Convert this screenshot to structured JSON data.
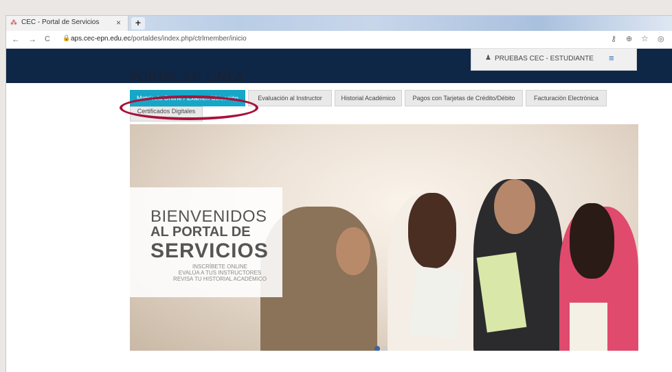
{
  "browser": {
    "tab_title": "CEC - Portal de Servicios",
    "tab_close": "×",
    "new_tab": "+",
    "back": "←",
    "forward": "→",
    "reload": "C",
    "lock": "🔒",
    "url_host": "aps.cec-epn.edu.ec",
    "url_path": "/portaldes/index.php/ctrlmember/inicio",
    "key_icon": "⚷",
    "zoom_icon": "⊕",
    "star_icon": "☆",
    "ext_icon": "◎"
  },
  "header": {
    "portal_title": "PORTAL EN LÍNEA",
    "user_label": "PRUEBAS CEC - ESTUDIANTE",
    "user_icon": "♟",
    "menu_icon": "≡"
  },
  "nav": {
    "items": [
      {
        "label": "Matrícula Online / Examen Ubicación",
        "active": true
      },
      {
        "label": "Evaluación al Instructor",
        "active": false
      },
      {
        "label": "Historial Académico",
        "active": false
      },
      {
        "label": "Pagos con Tarjetas de Crédito/Débito",
        "active": false
      },
      {
        "label": "Facturación Electrónica",
        "active": false
      },
      {
        "label": "Certificados Digitales",
        "active": false
      }
    ]
  },
  "hero": {
    "line1": "BIENVENIDOS",
    "line2": "AL PORTAL DE",
    "line3": "SERVICIOS",
    "sub1": "INSCRÍBETE ONLINE",
    "sub2": "EVALÚA A TUS INSTRUCTORES",
    "sub3": "REVISA TU HISTORIAL ACADÉMICO"
  },
  "colors": {
    "header_band": "#0e2747",
    "active_tab": "#16a6c8",
    "highlight_ring": "#a8123a"
  }
}
